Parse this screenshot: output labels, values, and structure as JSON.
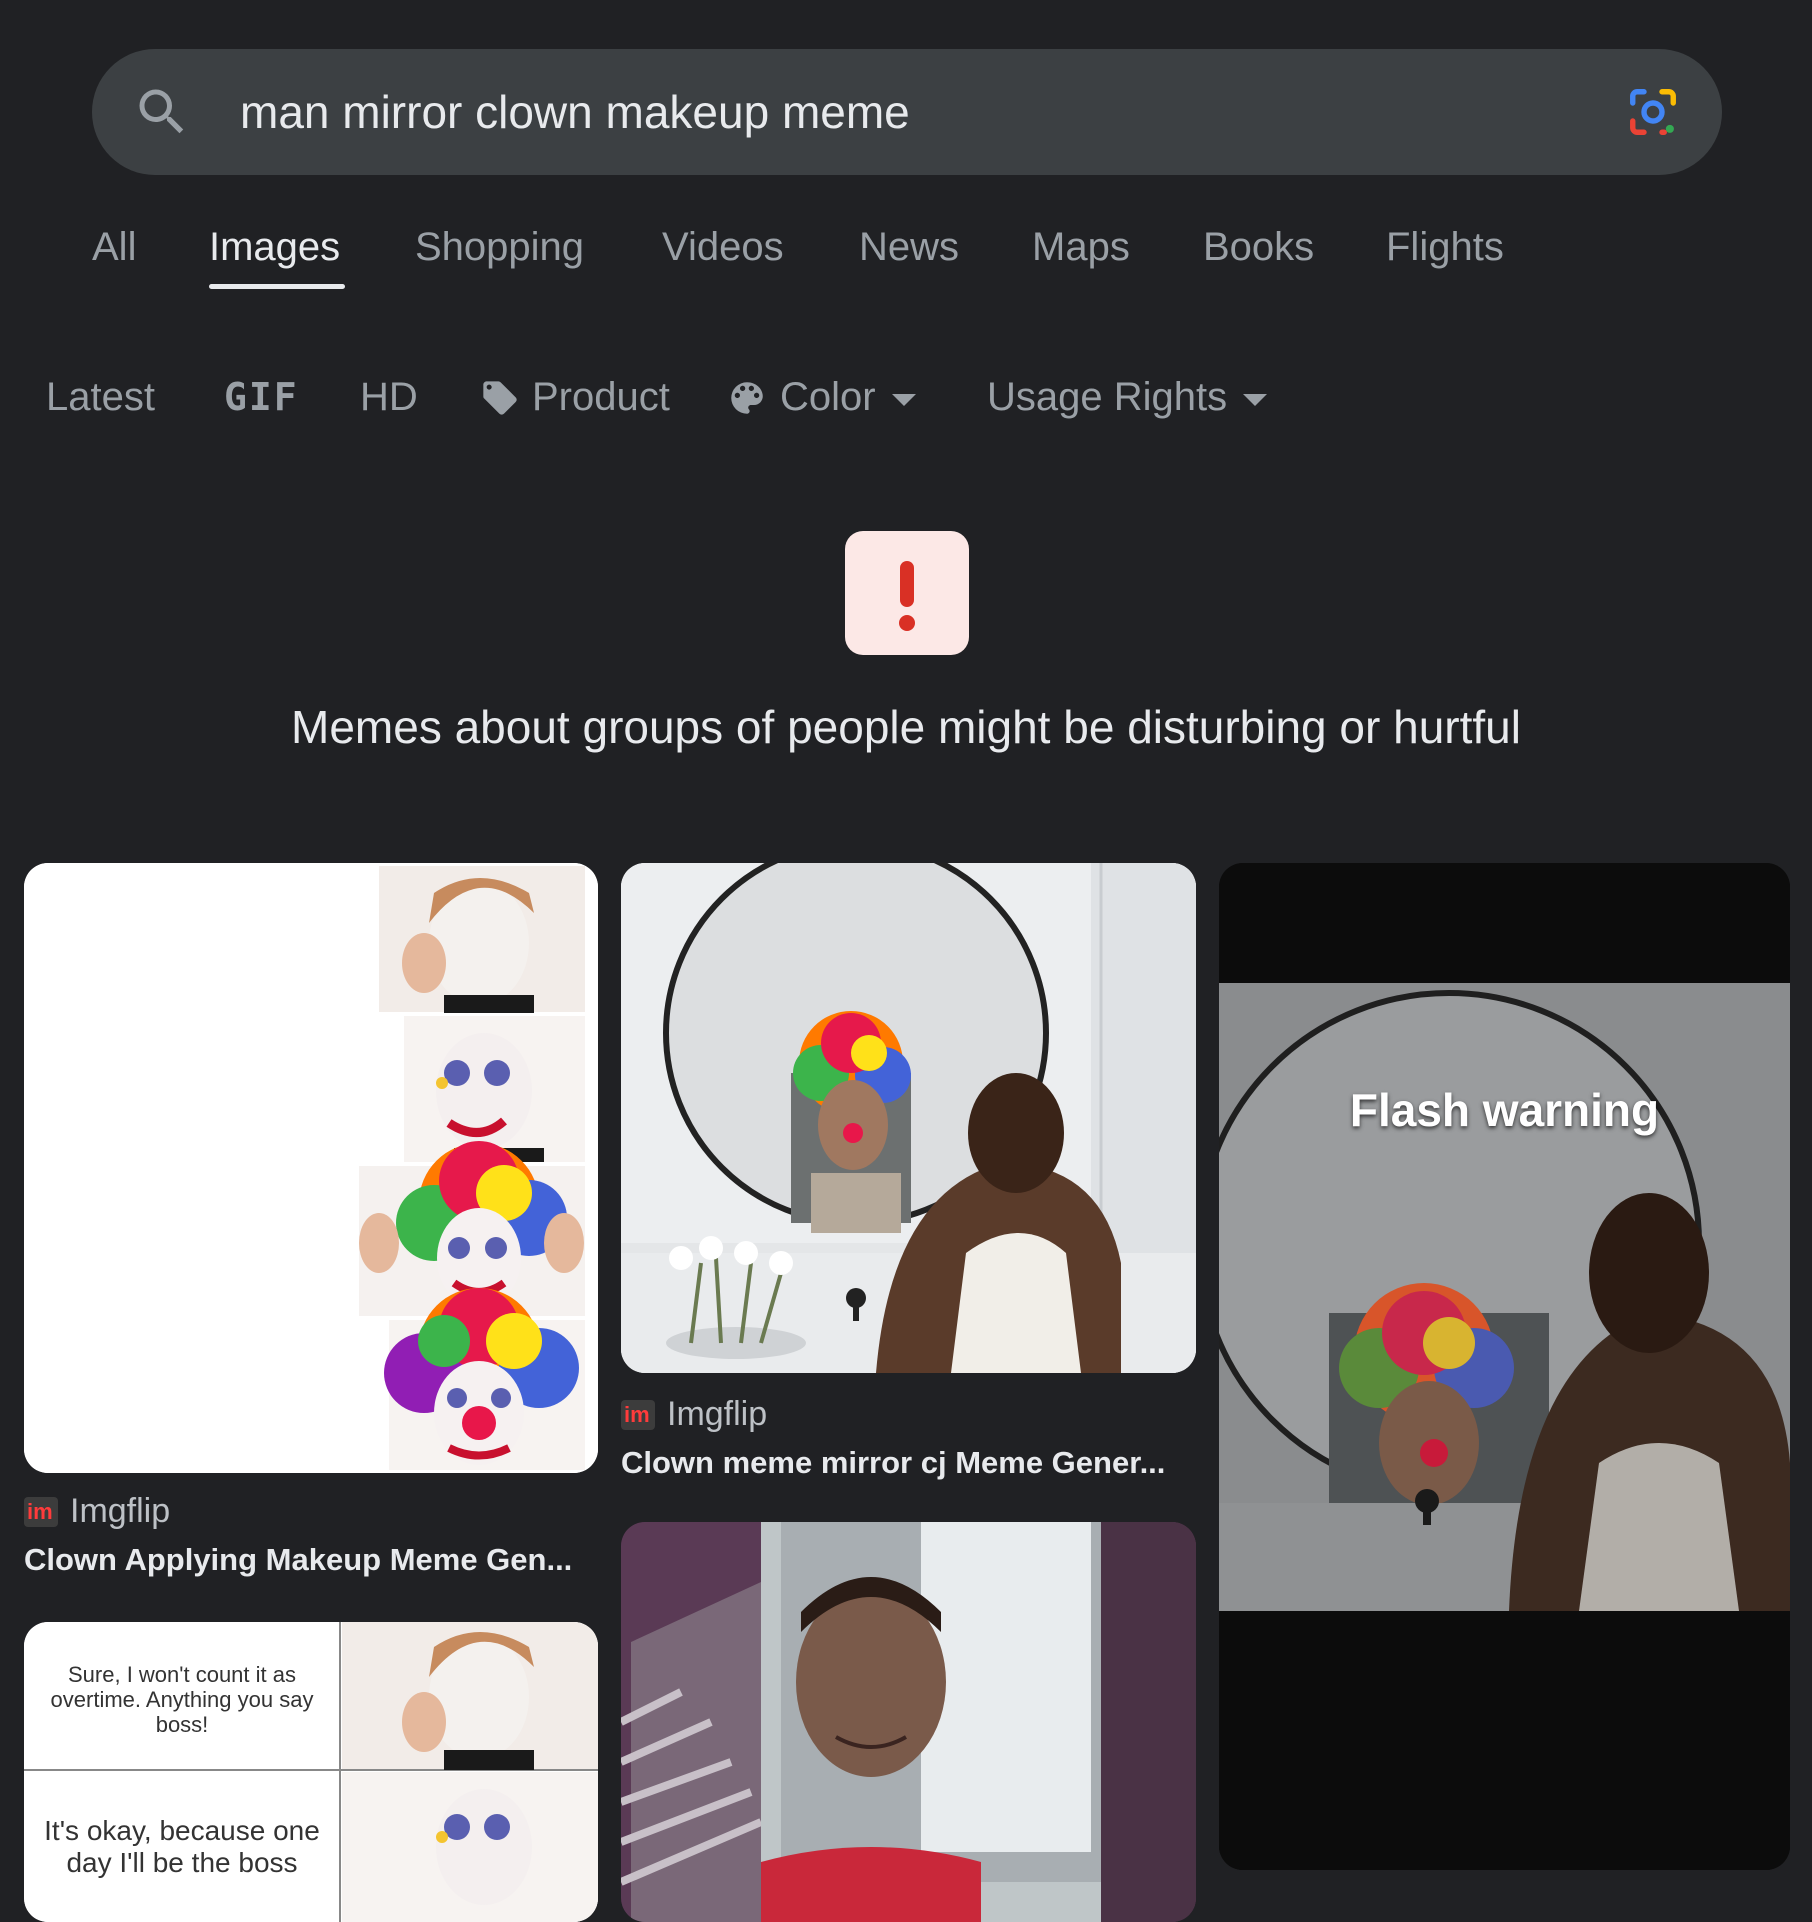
{
  "search": {
    "query": "man mirror clown makeup meme"
  },
  "tabs": [
    {
      "label": "All"
    },
    {
      "label": "Images"
    },
    {
      "label": "Shopping"
    },
    {
      "label": "Videos"
    },
    {
      "label": "News"
    },
    {
      "label": "Maps"
    },
    {
      "label": "Books"
    },
    {
      "label": "Flights"
    }
  ],
  "active_tab": "Images",
  "chips": {
    "latest": "Latest",
    "gif": "GIF",
    "hd": "HD",
    "product": "Product",
    "color": "Color",
    "usage_rights": "Usage Rights"
  },
  "warning": {
    "message": "Memes about groups of people might be disturbing or hurtful"
  },
  "results": [
    {
      "source": "Imgflip",
      "title": "Clown Applying Makeup Meme Gen..."
    },
    {
      "source": "Imgflip",
      "title": "Clown meme mirror cj Meme Gener..."
    },
    {
      "overlay": "Flash warning"
    },
    {
      "text_top": "Sure, I won't count it as overtime. Anything you say boss!",
      "text_bottom": "It's okay, because one day I'll be the boss"
    }
  ],
  "colors": {
    "background": "#202124",
    "search_bar": "#3c4043",
    "warning_bg": "#fce8e6",
    "warning_icon": "#d93025"
  }
}
